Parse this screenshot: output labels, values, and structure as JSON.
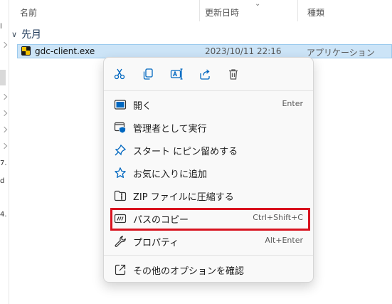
{
  "columns": {
    "name": "名前",
    "modified": "更新日時",
    "type": "種類"
  },
  "group": {
    "label": "先月"
  },
  "file": {
    "name": "gdc-client.exe",
    "modified": "2023/10/11 22:16",
    "type": "アプリケーション"
  },
  "left_fragments": [
    "l",
    "7.",
    "d",
    "4."
  ],
  "context_menu": {
    "toolbar": [
      {
        "icon": "cut-icon"
      },
      {
        "icon": "copy-icon"
      },
      {
        "icon": "rename-icon"
      },
      {
        "icon": "share-icon"
      },
      {
        "icon": "delete-icon"
      }
    ],
    "items": [
      {
        "label": "開く",
        "shortcut": "Enter",
        "icon": "open-icon"
      },
      {
        "label": "管理者として実行",
        "shortcut": "",
        "icon": "run-as-admin-icon"
      },
      {
        "label": "スタート にピン留めする",
        "shortcut": "",
        "icon": "pin-icon"
      },
      {
        "label": "お気に入りに追加",
        "shortcut": "",
        "icon": "star-icon"
      },
      {
        "label": "ZIP ファイルに圧縮する",
        "shortcut": "",
        "icon": "zip-folder-icon"
      },
      {
        "label": "パスのコピー",
        "shortcut": "Ctrl+Shift+C",
        "icon": "copy-path-icon"
      },
      {
        "label": "プロパティ",
        "shortcut": "Alt+Enter",
        "icon": "wrench-icon"
      },
      {
        "label": "その他のオプションを確認",
        "shortcut": "",
        "icon": "more-options-icon"
      }
    ],
    "highlight_color": "#d8121e",
    "accent_color": "#0067c0"
  }
}
